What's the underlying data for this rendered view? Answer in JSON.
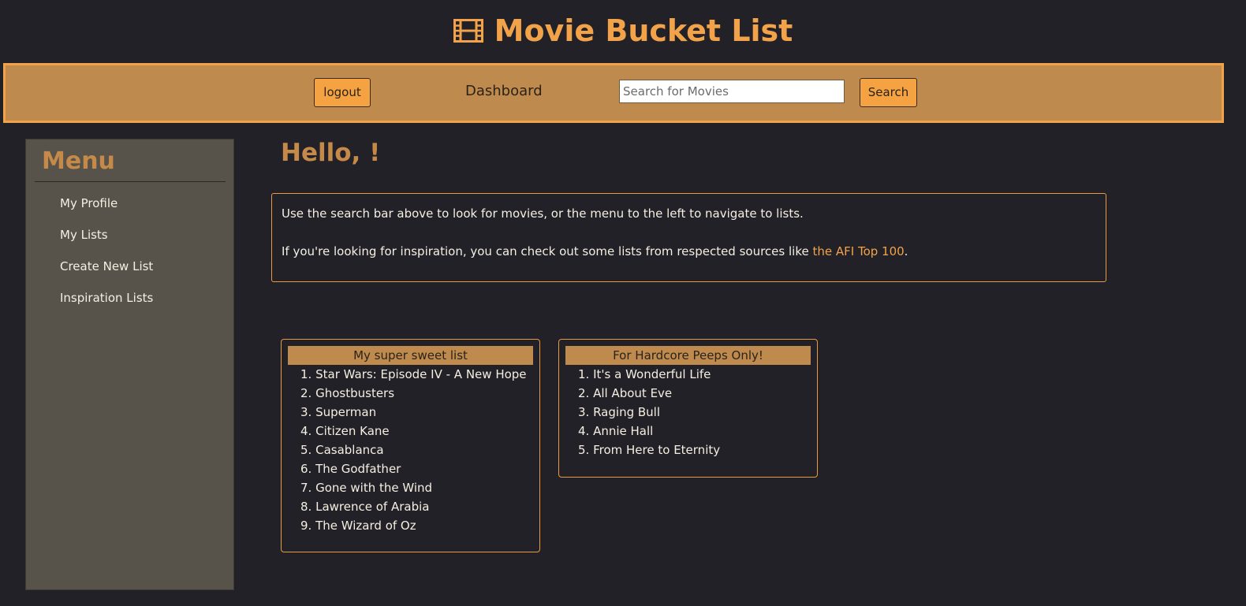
{
  "header": {
    "title": "Movie Bucket List",
    "icon": "film-icon"
  },
  "navbar": {
    "logout_label": "logout",
    "dashboard_label": "Dashboard",
    "search_placeholder": "Search for Movies",
    "search_value": "",
    "search_label": "Search"
  },
  "sidebar": {
    "heading": "Menu",
    "items": [
      {
        "label": "My Profile"
      },
      {
        "label": "My Lists"
      },
      {
        "label": "Create New List"
      },
      {
        "label": "Inspiration Lists"
      }
    ]
  },
  "main": {
    "greeting": "Hello, !",
    "info": {
      "line1": "Use the search bar above to look for movies, or the menu to the left to navigate to lists.",
      "line2_before": "If you're looking for inspiration, you can check out some lists from respected sources like ",
      "line2_link": "the AFI Top 100",
      "line2_after": "."
    },
    "lists": [
      {
        "title": "My super sweet list",
        "movies": [
          "Star Wars: Episode IV - A New Hope",
          "Ghostbusters",
          "Superman",
          "Citizen Kane",
          "Casablanca",
          "The Godfather",
          "Gone with the Wind",
          "Lawrence of Arabia",
          "The Wizard of Oz"
        ]
      },
      {
        "title": "For Hardcore Peeps Only!",
        "movies": [
          "It's a Wonderful Life",
          "All About Eve",
          "Raging Bull",
          "Annie Hall",
          "From Here to Eternity"
        ]
      }
    ]
  },
  "colors": {
    "background": "#222127",
    "accent": "#f2a34a",
    "navbar": "#bf8a4e",
    "sidebar": "#58534a"
  }
}
